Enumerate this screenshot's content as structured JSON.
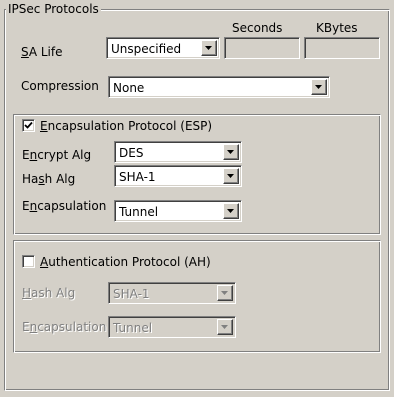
{
  "ipsec": {
    "title": "IPSec Protocols",
    "seconds_header": "Seconds",
    "kbytes_header": "KBytes",
    "sa_life": {
      "label_u": "S",
      "label_rest": "A Life",
      "value": "Unspecified",
      "seconds": "",
      "kbytes": ""
    },
    "compression": {
      "label": "Compression",
      "value": "None"
    }
  },
  "esp": {
    "checked": true,
    "label_u": "E",
    "label_rest": "ncapsulation Protocol (ESP)",
    "encrypt": {
      "label_a": "E",
      "label_u": "n",
      "label_rest": "crypt Alg",
      "value": "DES"
    },
    "hash": {
      "label_a": "Ha",
      "label_u": "s",
      "label_rest": "h Alg",
      "value": "SHA-1"
    },
    "encapsulation": {
      "label_a": "E",
      "label_u": "n",
      "label_rest": "capsulation",
      "value": "Tunnel"
    }
  },
  "ah": {
    "checked": false,
    "label_u": "A",
    "label_rest": "uthentication Protocol (AH)",
    "hash": {
      "label_u": "H",
      "label_rest": "ash Alg",
      "value": "SHA-1"
    },
    "encapsulation": {
      "label_a": "E",
      "label_u": "n",
      "label_rest": "capsulation",
      "value": "Tunnel"
    }
  }
}
